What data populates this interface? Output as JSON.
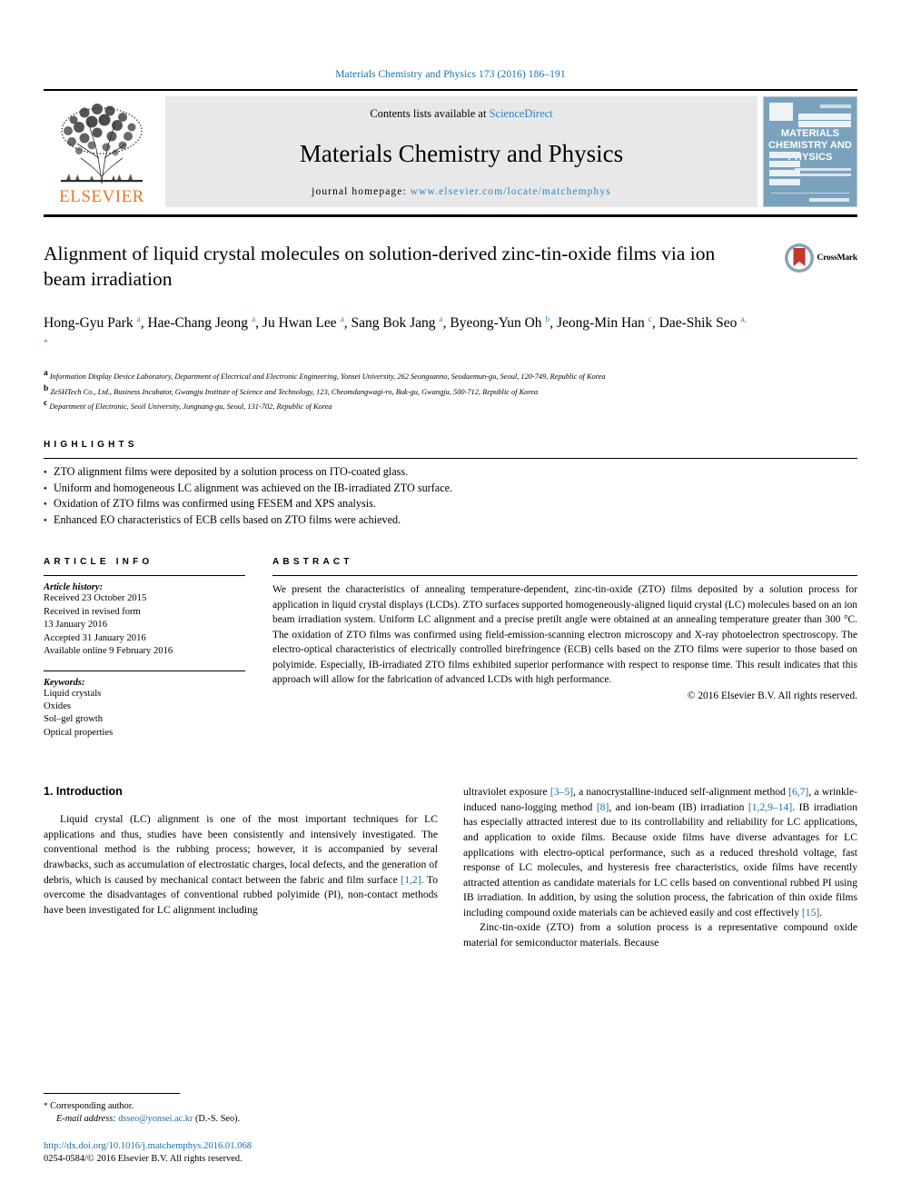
{
  "running_head": "Materials Chemistry and Physics 173 (2016) 186–191",
  "masthead": {
    "contents_prefix": "Contents lists available at ",
    "sciencedirect": "ScienceDirect",
    "journal_title": "Materials Chemistry and Physics",
    "homepage_label": "journal homepage: ",
    "homepage_url": "www.elsevier.com/locate/matchemphys",
    "publisher": "ELSEVIER",
    "cover_title": "MATERIALS CHEMISTRY AND PHYSICS",
    "accent_orange": "#E87722",
    "accent_blue": "#2b86c5",
    "cover_bg": "#7ba2bd"
  },
  "article": {
    "title": "Alignment of liquid crystal molecules on solution-derived zinc-tin-oxide films via ion beam irradiation",
    "crossmark_label": "CrossMark",
    "authors": [
      {
        "name": "Hong-Gyu Park",
        "marks": "a"
      },
      {
        "name": "Hae-Chang Jeong",
        "marks": "a"
      },
      {
        "name": "Ju Hwan Lee",
        "marks": "a"
      },
      {
        "name": "Sang Bok Jang",
        "marks": "a"
      },
      {
        "name": "Byeong-Yun Oh",
        "marks": "b"
      },
      {
        "name": "Jeong-Min Han",
        "marks": "c"
      },
      {
        "name": "Dae-Shik Seo",
        "marks": "a, *"
      }
    ],
    "affiliations": [
      {
        "mark": "a",
        "text": "Information Display Device Laboratory, Department of Electrical and Electronic Engineering, Yonsei University, 262 Seongsanno, Seodaemun-gu, Seoul, 120-749, Republic of Korea"
      },
      {
        "mark": "b",
        "text": "ZeSHTech Co., Ltd., Business Incubator, Gwangju Institute of Science and Technology, 123, Cheomdangwagi-ro, Buk-gu, Gwangju, 500-712, Republic of Korea"
      },
      {
        "mark": "c",
        "text": "Department of Electronic, Seoil University, Jungnang-gu, Seoul, 131-702, Republic of Korea"
      }
    ]
  },
  "highlights": {
    "label": "HIGHLIGHTS",
    "items": [
      "ZTO alignment films were deposited by a solution process on ITO-coated glass.",
      "Uniform and homogeneous LC alignment was achieved on the IB-irradiated ZTO surface.",
      "Oxidation of ZTO films was confirmed using FESEM and XPS analysis.",
      "Enhanced EO characteristics of ECB cells based on ZTO films were achieved."
    ]
  },
  "article_info": {
    "label": "ARTICLE INFO",
    "history_label": "Article history:",
    "history": [
      "Received 23 October 2015",
      "Received in revised form",
      "13 January 2016",
      "Accepted 31 January 2016",
      "Available online 9 February 2016"
    ],
    "keywords_label": "Keywords:",
    "keywords": [
      "Liquid crystals",
      "Oxides",
      "Sol–gel growth",
      "Optical properties"
    ]
  },
  "abstract": {
    "label": "ABSTRACT",
    "text": "We present the characteristics of annealing temperature-dependent, zinc-tin-oxide (ZTO) films deposited by a solution process for application in liquid crystal displays (LCDs). ZTO surfaces supported homogeneously-aligned liquid crystal (LC) molecules based on an ion beam irradiation system. Uniform LC alignment and a precise pretilt angle were obtained at an annealing temperature greater than 300 °C. The oxidation of ZTO films was confirmed using field-emission-scanning electron microscopy and X-ray photoelectron spectroscopy. The electro-optical characteristics of electrically controlled birefringence (ECB) cells based on the ZTO films were superior to those based on polyimide. Especially, IB-irradiated ZTO films exhibited superior performance with respect to response time. This result indicates that this approach will allow for the fabrication of advanced LCDs with high performance.",
    "copyright": "© 2016 Elsevier B.V. All rights reserved."
  },
  "body": {
    "section_heading": "1. Introduction",
    "left_paragraphs": [
      "Liquid crystal (LC) alignment is one of the most important techniques for LC applications and thus, studies have been consistently and intensively investigated. The conventional method is the rubbing process; however, it is accompanied by several drawbacks, such as accumulation of electrostatic charges, local defects, and the generation of debris, which is caused by mechanical contact between the fabric and film surface [1,2]. To overcome the disadvantages of conventional rubbed polyimide (PI), non-contact methods have been investigated for LC alignment including"
    ],
    "right_paragraphs": [
      "ultraviolet exposure [3–5], a nanocrystalline-induced self-alignment method [6,7], a wrinkle-induced nano-logging method [8], and ion-beam (IB) irradiation [1,2,9–14]. IB irradiation has especially attracted interest due to its controllability and reliability for LC applications, and application to oxide films. Because oxide films have diverse advantages for LC applications with electro-optical performance, such as a reduced threshold voltage, fast response of LC molecules, and hysteresis free characteristics, oxide films have recently attracted attention as candidate materials for LC cells based on conventional rubbed PI using IB irradiation. In addition, by using the solution process, the fabrication of thin oxide films including compound oxide materials can be achieved easily and cost effectively [15].",
      "Zinc-tin-oxide (ZTO) from a solution process is a representative compound oxide material for semiconductor materials. Because"
    ],
    "citations_left": [
      "[1,2]"
    ],
    "citations_right": [
      "[3–5]",
      "[6,7]",
      "[8]",
      "[1,2,9–14]",
      "[15]"
    ]
  },
  "footer": {
    "corresponding": "Corresponding author.",
    "email_label": "E-mail address: ",
    "email": "dsseo@yonsei.ac.kr",
    "email_suffix": " (D.-S. Seo).",
    "doi": "http://dx.doi.org/10.1016/j.matchemphys.2016.01.068",
    "issn": "0254-0584/© 2016 Elsevier B.V. All rights reserved."
  }
}
